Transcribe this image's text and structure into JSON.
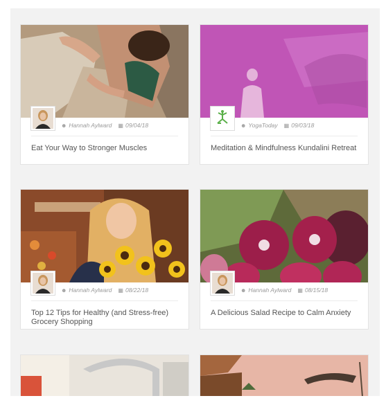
{
  "posts": [
    {
      "title": "Eat Your Way to Stronger Muscles",
      "author": "Hannah Aylward",
      "date": "09/04/18",
      "author_icon": "user-icon",
      "date_icon": "calendar-icon",
      "image": "rock-climber-photo",
      "avatar": "hannah-avatar"
    },
    {
      "title": "Meditation & Mindfulness Kundalini Retreat",
      "author": "YogaToday",
      "date": "09/03/18",
      "author_icon": "user-icon",
      "date_icon": "calendar-icon",
      "image": "yoga-meditation-photo",
      "avatar": "yogatoday-logo-avatar"
    },
    {
      "title": "Top 12 Tips for Healthy (and Stress-free) Grocery Shopping",
      "author": "Hannah Aylward",
      "date": "08/22/18",
      "author_icon": "user-icon",
      "date_icon": "calendar-icon",
      "image": "sunflowers-market-photo",
      "avatar": "hannah-avatar"
    },
    {
      "title": "A Delicious Salad Recipe to Calm Anxiety",
      "author": "Hannah Aylward",
      "date": "08/15/18",
      "author_icon": "user-icon",
      "date_icon": "calendar-icon",
      "image": "red-onions-photo",
      "avatar": "hannah-avatar"
    }
  ],
  "partial_posts": [
    {
      "image": "kitchen-faucet-photo"
    },
    {
      "image": "desert-sunset-photo"
    }
  ],
  "colors": {
    "background": "#f2f2f2",
    "card": "#ffffff",
    "title_text": "#555555",
    "meta_text": "#9a9a9a",
    "yoga_overlay": "#c85bbf"
  }
}
